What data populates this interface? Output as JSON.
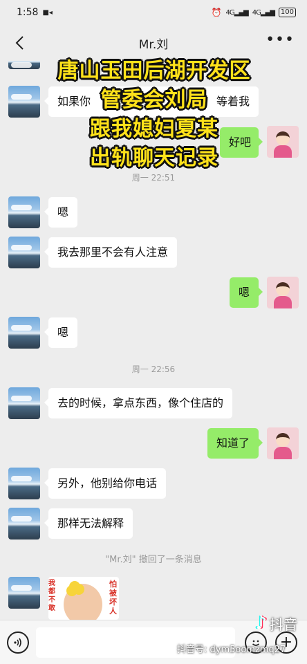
{
  "status": {
    "time": "1:58",
    "battery": "100"
  },
  "header": {
    "title": "Mr.刘",
    "back_icon": "back-arrow-icon",
    "more_icon": "more-icon"
  },
  "messages": [
    {
      "side": "left",
      "text": "如果你",
      "text_end": "等着我"
    },
    {
      "side": "right",
      "text": "好吧"
    },
    {
      "type": "time",
      "text": "周一 22:51"
    },
    {
      "side": "left",
      "text": "嗯"
    },
    {
      "side": "left",
      "text": "我去那里不会有人注意"
    },
    {
      "side": "right",
      "text": "嗯"
    },
    {
      "side": "left",
      "text": "嗯"
    },
    {
      "type": "time",
      "text": "周一 22:56"
    },
    {
      "side": "left",
      "text": "去的时候，拿点东西，像个住店的"
    },
    {
      "side": "right",
      "text": "知道了"
    },
    {
      "side": "left",
      "text": "另外，他别给你电话"
    },
    {
      "side": "left",
      "text": "那样无法解释"
    },
    {
      "type": "recall",
      "text": "\"Mr.刘\" 撤回了一条消息"
    },
    {
      "side": "left",
      "type": "sticker",
      "text_left": "我都不敢",
      "text_right": "怕被坏人"
    }
  ],
  "overlay": {
    "lines": [
      "唐山玉田后湖开发区",
      "管委会刘局",
      "跟我媳妇夏某",
      "出轨聊天记录"
    ],
    "color": "#ffe21a"
  },
  "input": {
    "placeholder": ""
  },
  "watermark": {
    "brand": "抖音",
    "id": "抖音号: dym5oomzmq27"
  },
  "colors": {
    "right_bubble": "#95ec69",
    "left_bubble": "#ffffff",
    "background": "#ededed"
  }
}
